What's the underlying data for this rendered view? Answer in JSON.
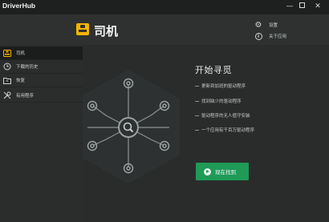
{
  "window": {
    "app_name": "DriverHub",
    "minimize": "—",
    "close": "✕"
  },
  "header": {
    "title": "司机",
    "settings_label": "设置",
    "about_label": "关于应用"
  },
  "sidebar": {
    "items": [
      {
        "label": "司机",
        "icon": "driver-box-icon",
        "active": true
      },
      {
        "label": "下载的历史",
        "icon": "clock-icon",
        "active": false
      },
      {
        "label": "恢复",
        "icon": "folder-icon",
        "active": false
      },
      {
        "label": "有用程序",
        "icon": "tools-icon",
        "active": false
      }
    ]
  },
  "main": {
    "start_title": "开始寻觅",
    "features": [
      "更新到加班的驱动程序",
      "找到缺少的驱动程序",
      "驱动程序的无人值守安装",
      "一个应用有千百万驱动程序"
    ],
    "scan_button_label": "现在找到"
  },
  "colors": {
    "accent": "#f5b400",
    "button_green": "#1f9a57",
    "background": "#2a2c2c",
    "titlebar": "#1e1f1f"
  }
}
